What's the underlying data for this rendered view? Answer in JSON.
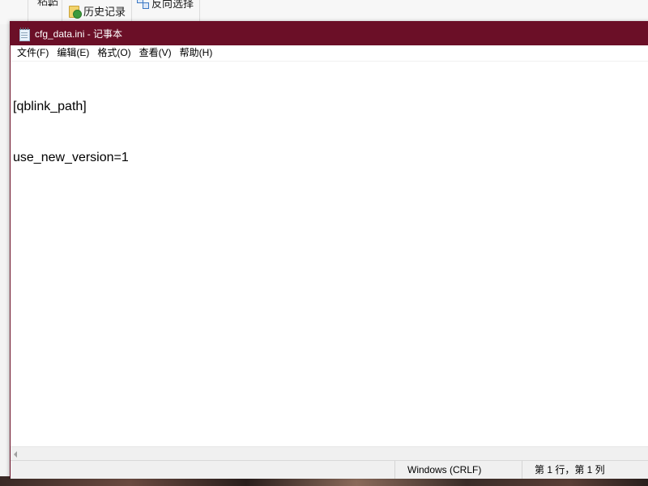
{
  "background_window": {
    "truncated_label": "粘贴",
    "history_label": "历史记录",
    "invert_select_label": "反向选择"
  },
  "notepad": {
    "title": "cfg_data.ini - 记事本",
    "menu": [
      {
        "label": "文件(F)"
      },
      {
        "label": "编辑(E)"
      },
      {
        "label": "格式(O)"
      },
      {
        "label": "查看(V)"
      },
      {
        "label": "帮助(H)"
      }
    ],
    "content_lines": [
      "[qblink_path]",
      "use_new_version=1"
    ],
    "status": {
      "encoding_line_ending": "Windows (CRLF)",
      "cursor_position": "第 1 行，第 1 列"
    },
    "colors": {
      "titlebar": "#6b0f27",
      "title_text": "#ffffff"
    }
  }
}
